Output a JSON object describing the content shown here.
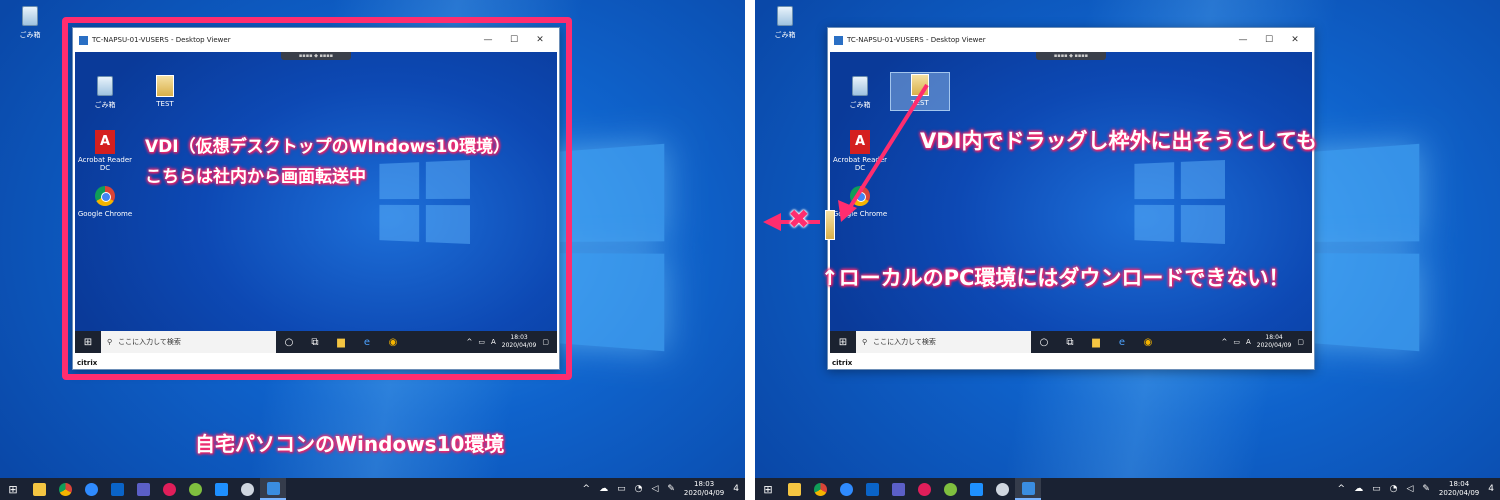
{
  "left": {
    "desktop_icon": "ごみ箱",
    "viewer": {
      "title": "TC-NAPSU-01-VUSERS - Desktop Viewer",
      "icons": [
        "ごみ箱",
        "TEST",
        "Acrobat Reader DC",
        "Google Chrome"
      ],
      "search_placeholder": "ここに入力して検索",
      "clock_time": "18:03",
      "clock_date": "2020/04/09",
      "ime": "A",
      "citrix": "citrix"
    },
    "annotation_vdi_line1": "VDI（仮想デスクトップのWIndows10環境）",
    "annotation_vdi_line2": "こちらは社内から画面転送中",
    "annotation_home": "自宅パソコンのWindows10環境",
    "taskbar": {
      "clock_time": "18:03",
      "clock_date": "2020/04/09",
      "notification_count": "4"
    }
  },
  "right": {
    "desktop_icon": "ごみ箱",
    "viewer": {
      "title": "TC-NAPSU-01-VUSERS - Desktop Viewer",
      "icons": [
        "ごみ箱",
        "TEST",
        "Acrobat Reader DC",
        "Google Chrome"
      ],
      "search_placeholder": "ここに入力して検索",
      "clock_time": "18:04",
      "clock_date": "2020/04/09",
      "ime": "A",
      "citrix": "citrix"
    },
    "annotation_drag": "VDI内でドラッグし枠外に出そうとしても",
    "annotation_nodownload": "↑ローカルのPC環境にはダウンロードできない！",
    "taskbar": {
      "clock_time": "18:04",
      "clock_date": "2020/04/09",
      "notification_count": "4"
    }
  },
  "colors": {
    "accent": "#ff2d6f",
    "desktop_blue": "#0f63cc",
    "taskbar": "#1a2233"
  },
  "icons": [
    "windows-start-icon",
    "search-icon",
    "recycle-bin-icon",
    "pdf-icon",
    "chrome-icon",
    "close-x-icon"
  ]
}
